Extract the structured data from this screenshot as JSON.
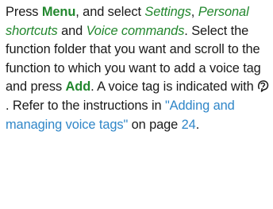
{
  "paragraph": {
    "t1": "Press ",
    "menu": "Menu",
    "t2": ", and select ",
    "settings": "Settings",
    "t3": ", ",
    "personal_shortcuts": "Personal shortcuts",
    "t4": " and ",
    "voice_commands": "Voice commands",
    "t5": ". Select the function folder that you want and scroll to the function to which you want to add a voice tag and press ",
    "add": "Add",
    "t6": ". A voice tag is indicated with ",
    "voice_tag_icon": "voice-tag-icon",
    "t7": ". Refer to the instructions in ",
    "link_text": "\"Adding and managing voice tags\"",
    "t8": " on page ",
    "page_number": "24",
    "t9": "."
  },
  "colors": {
    "text": "#1a1a1a",
    "keyword_green": "#22872e",
    "link_blue": "#2f86c8"
  }
}
